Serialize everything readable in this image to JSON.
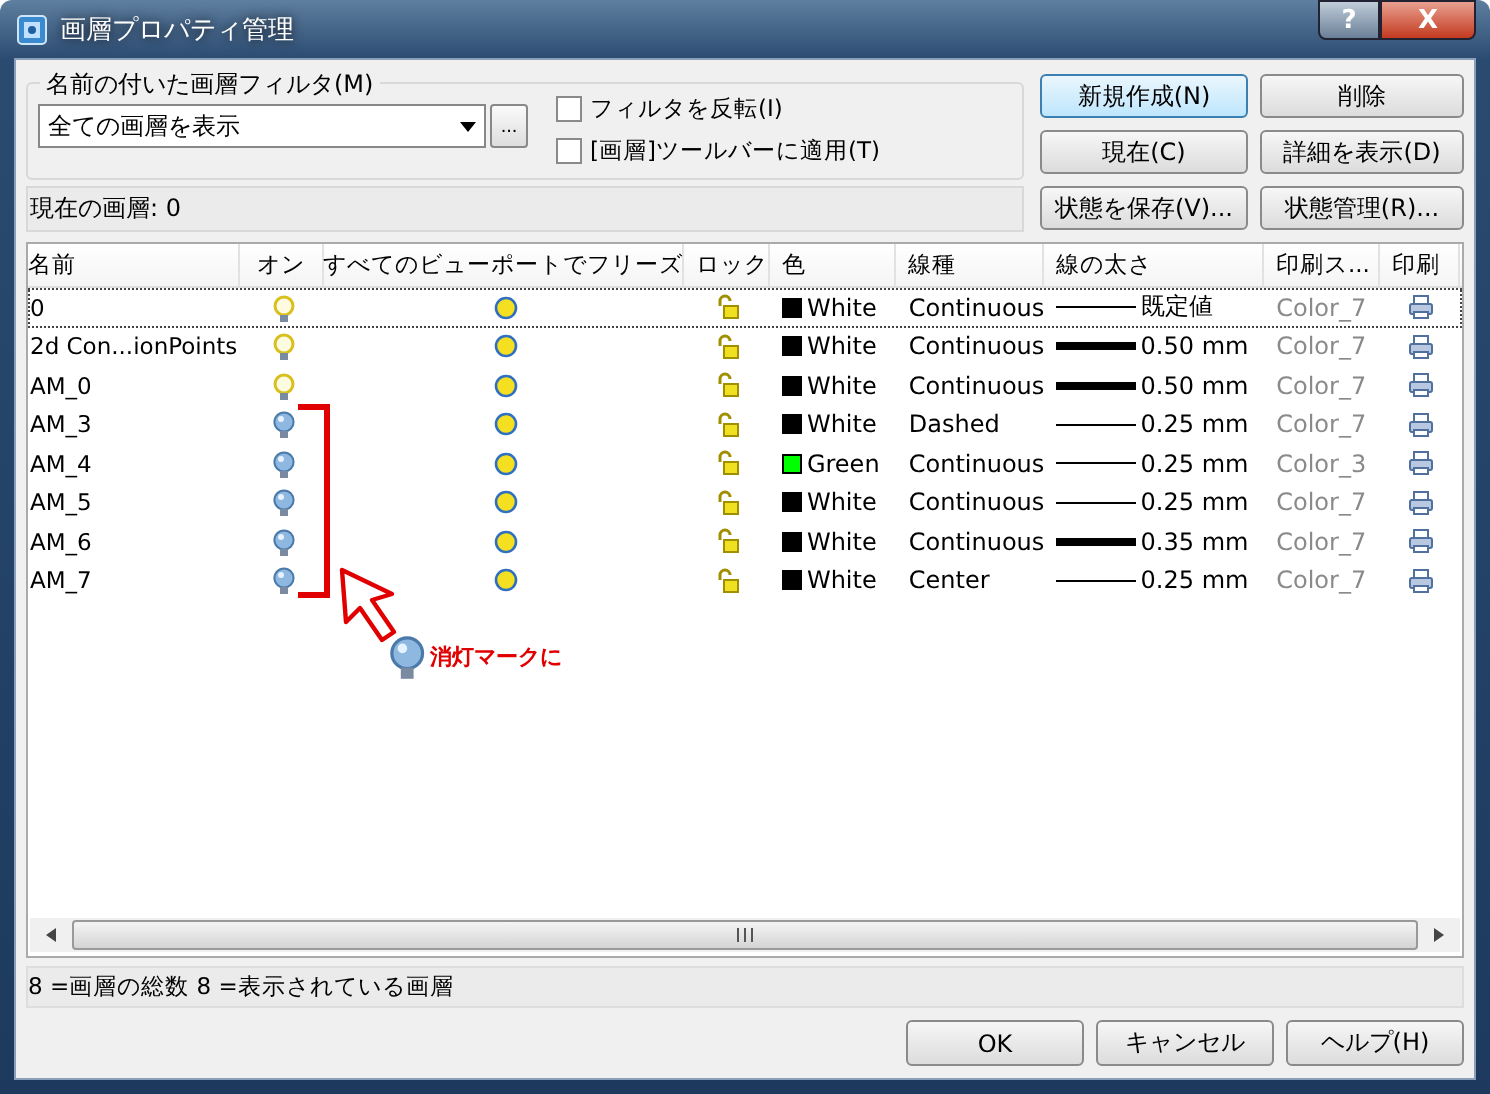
{
  "window": {
    "title": "画層プロパティ管理",
    "help_button": "?",
    "close_button": "X"
  },
  "filter_group": {
    "label": "名前の付いた画層フィルタ(M)",
    "dropdown_value": "全ての画層を表示",
    "browse_button": "...",
    "checkboxes": [
      {
        "label": "フィルタを反転(I)",
        "checked": false
      },
      {
        "label": "[画層]ツールバーに適用(T)",
        "checked": false
      }
    ]
  },
  "current_layer": "現在の画層:  0",
  "side_buttons": [
    {
      "label": "新規作成(N)",
      "default": true
    },
    {
      "label": "削除",
      "default": false
    },
    {
      "label": "現在(C)",
      "default": false
    },
    {
      "label": "詳細を表示(D)",
      "default": false
    },
    {
      "label": "状態を保存(V)...",
      "default": false
    },
    {
      "label": "状態管理(R)...",
      "default": false
    }
  ],
  "table": {
    "columns": [
      "名前",
      "オン",
      "すべてのビューポートでフリーズ",
      "ロック",
      "色",
      "線種",
      "線の太さ",
      "印刷ス...",
      "印刷"
    ],
    "rows": [
      {
        "name": "0",
        "on": true,
        "selected": true,
        "color": "#000000",
        "color_name": "White",
        "linetype": "Continuous",
        "thick_line": false,
        "lineweight": "既定値",
        "plot_style": "Color_7"
      },
      {
        "name": "2d Con...ionPoints",
        "on": true,
        "selected": false,
        "color": "#000000",
        "color_name": "White",
        "linetype": "Continuous",
        "thick_line": true,
        "lineweight": "0.50 mm",
        "plot_style": "Color_7"
      },
      {
        "name": "AM_0",
        "on": true,
        "selected": false,
        "color": "#000000",
        "color_name": "White",
        "linetype": "Continuous",
        "thick_line": true,
        "lineweight": "0.50 mm",
        "plot_style": "Color_7"
      },
      {
        "name": "AM_3",
        "on": false,
        "selected": false,
        "color": "#000000",
        "color_name": "White",
        "linetype": "Dashed",
        "thick_line": false,
        "lineweight": "0.25 mm",
        "plot_style": "Color_7"
      },
      {
        "name": "AM_4",
        "on": false,
        "selected": false,
        "color": "#00ff00",
        "color_name": "Green",
        "linetype": "Continuous",
        "thick_line": false,
        "lineweight": "0.25 mm",
        "plot_style": "Color_3"
      },
      {
        "name": "AM_5",
        "on": false,
        "selected": false,
        "color": "#000000",
        "color_name": "White",
        "linetype": "Continuous",
        "thick_line": false,
        "lineweight": "0.25 mm",
        "plot_style": "Color_7"
      },
      {
        "name": "AM_6",
        "on": false,
        "selected": false,
        "color": "#000000",
        "color_name": "White",
        "linetype": "Continuous",
        "thick_line": true,
        "lineweight": "0.35 mm",
        "plot_style": "Color_7"
      },
      {
        "name": "AM_7",
        "on": false,
        "selected": false,
        "color": "#000000",
        "color_name": "White",
        "linetype": "Center",
        "thick_line": false,
        "lineweight": "0.25 mm",
        "plot_style": "Color_7"
      }
    ]
  },
  "annotation": {
    "text": "消灯マークに"
  },
  "status_bar": "8 =画層の総数 8 =表示されている画層",
  "buttons": [
    "OK",
    "キャンセル",
    "ヘルプ(H)"
  ]
}
